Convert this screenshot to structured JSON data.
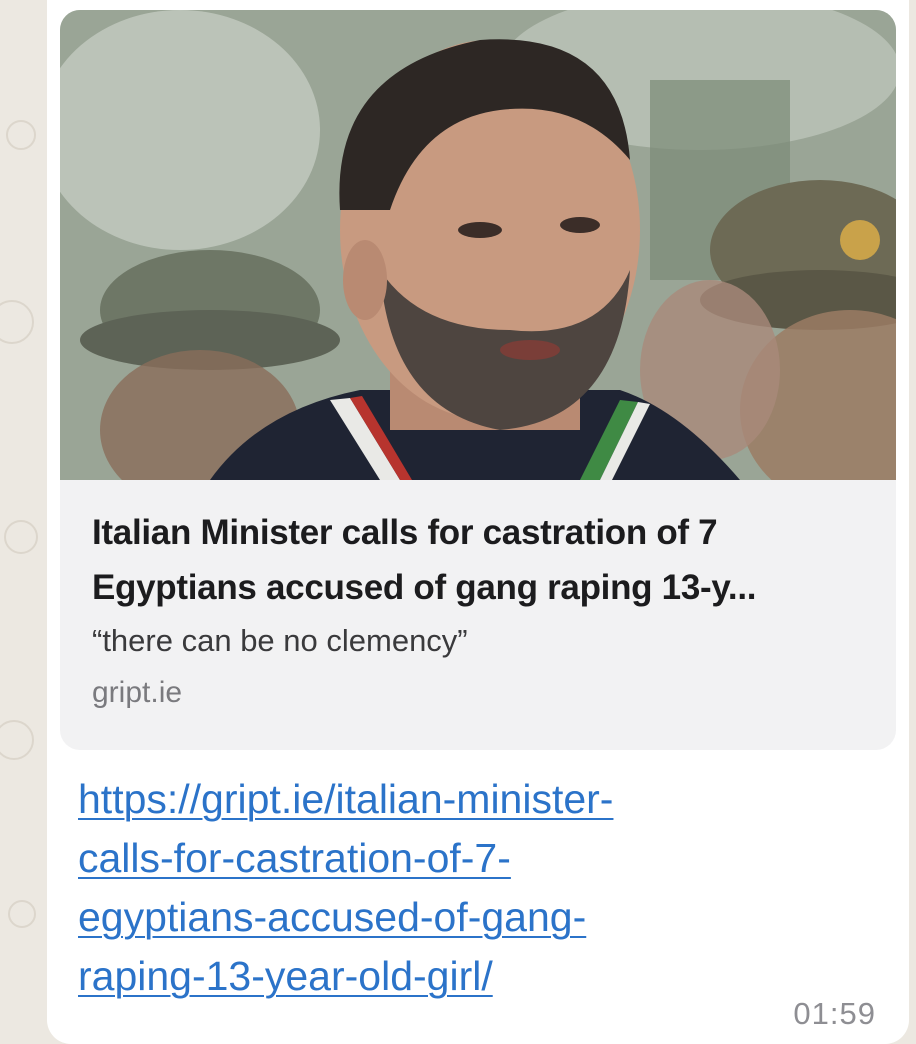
{
  "message": {
    "preview": {
      "image": "photo-of-man-in-crowd",
      "title_line1": "Italian Minister calls for castration of 7",
      "title_line2": "Egyptians accused of gang raping 13-y...",
      "description": "“there can be no clemency”",
      "domain": "gript.ie"
    },
    "link_lines": [
      "https://gript.ie/italian-minister-",
      "calls-for-castration-of-7-",
      "egyptians-accused-of-gang-",
      "raping-13-year-old-girl/"
    ],
    "timestamp": "01:59"
  },
  "colors": {
    "chat_background": "#ece8e1",
    "bubble": "#ffffff",
    "preview_card": "#f2f2f3",
    "link": "#2b73c9",
    "timestamp": "#8e8e93"
  }
}
